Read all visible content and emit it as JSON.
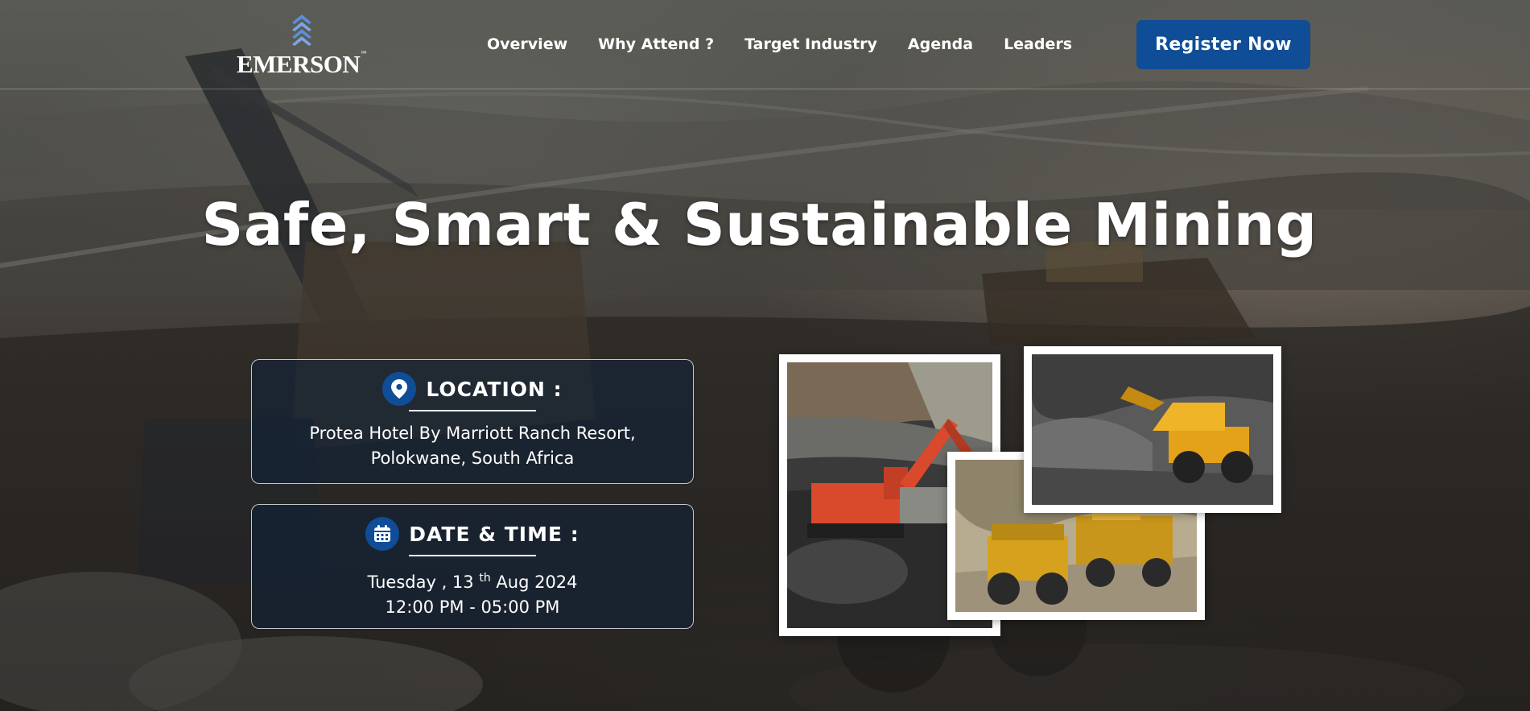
{
  "brand": {
    "name": "EMERSON",
    "logo_icon": "emerson-diamond-icon"
  },
  "nav": {
    "items": [
      {
        "label": "Overview"
      },
      {
        "label": "Why Attend ?"
      },
      {
        "label": "Target Industry"
      },
      {
        "label": "Agenda"
      },
      {
        "label": "Leaders"
      }
    ],
    "cta_label": "Register Now",
    "cta_color": "#0f4d96"
  },
  "hero": {
    "title": "Safe, Smart & Sustainable Mining"
  },
  "location": {
    "icon": "map-pin-icon",
    "heading": "LOCATION :",
    "line1": "Protea Hotel By Marriott Ranch Resort,",
    "line2": "Polokwane, South Africa"
  },
  "datetime": {
    "icon": "calendar-icon",
    "heading": "DATE & TIME :",
    "day": "Tuesday , 13",
    "ordinal": "th",
    "month_year": "Aug 2024",
    "time": "12:00 PM - 05:00 PM"
  },
  "collage": {
    "photos": [
      {
        "icon": "excavator-photo"
      },
      {
        "icon": "haul-truck-photo"
      },
      {
        "icon": "loader-truck-photo"
      }
    ]
  },
  "colors": {
    "accent": "#0f4d96",
    "card_bg": "#0c203a"
  }
}
